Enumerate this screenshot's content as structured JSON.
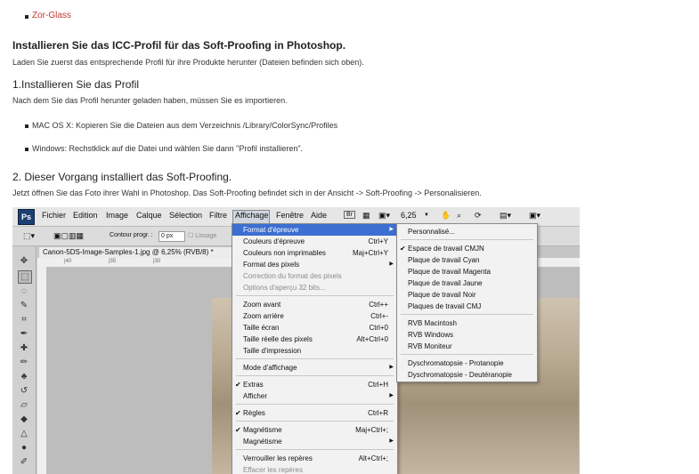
{
  "intro": {
    "link": "Zor-Glass"
  },
  "section1": {
    "heading": "Installieren Sie das ICC-Profil für das Soft-Proofing in Photoshop.",
    "text": "Laden Sie zuerst das entsprechende Profil für ihre Produkte herunter (Dateien befinden sich oben)."
  },
  "section2": {
    "heading": "1.Installieren Sie das Profil",
    "text": "Nach dem Sie das Profil herunter geladen haben, müssen Sie es importieren.",
    "bullets": [
      "MAC OS X: Kopieren Sie die Dateien aus dem Verzeichnis /Library/ColorSync/Profiles",
      "Windows: Rechstklick auf die Datei und wählen Sie dann \"Profil installieren\"."
    ]
  },
  "section3": {
    "heading": "2. Dieser Vorgang installiert das Soft-Proofing.",
    "text": "Jetzt öffnen Sie das Foto ihrer Wahl in Photoshop. Das Soft-Proofing befindet sich in der Ansicht -> Soft-Proofing -> Personalisieren."
  },
  "ps": {
    "logo": "Ps",
    "menus": [
      "Fichier",
      "Edition",
      "Image",
      "Calque",
      "Sélection",
      "Filtre",
      "Affichage",
      "Fenêtre",
      "Aide"
    ],
    "zoom": "6,25",
    "options": {
      "contour_label": "Contour progr. :",
      "contour_value": "0 px",
      "lissage": "Lissage"
    },
    "doc_tab": "Canon-5DS-Image-Samples-1.jpg @ 6,25% (RVB/8) *",
    "ruler_marks": [
      "|40",
      "|35",
      "|30"
    ],
    "dropdown": [
      {
        "label": "Format d'épreuve",
        "shortcut": "",
        "arrow": true,
        "hl": true
      },
      {
        "label": "Couleurs d'épreuve",
        "shortcut": "Ctrl+Y"
      },
      {
        "label": "Couleurs non imprimables",
        "shortcut": "Maj+Ctrl+Y"
      },
      {
        "label": "Format des pixels",
        "shortcut": "",
        "arrow": true
      },
      {
        "label": "Correction du format des pixels",
        "shortcut": "",
        "disabled": true
      },
      {
        "label": "Options d'aperçu 32 bits...",
        "shortcut": "",
        "disabled": true
      },
      {
        "label": "Zoom avant",
        "shortcut": "Ctrl++"
      },
      {
        "label": "Zoom arrière",
        "shortcut": "Ctrl+-"
      },
      {
        "label": "Taille écran",
        "shortcut": "Ctrl+0"
      },
      {
        "label": "Taille réelle des pixels",
        "shortcut": "Alt+Ctrl+0"
      },
      {
        "label": "Taille d'impression",
        "shortcut": ""
      },
      {
        "label": "Mode d'affichage",
        "shortcut": "",
        "arrow": true
      },
      {
        "label": "Extras",
        "shortcut": "Ctrl+H",
        "checked": true
      },
      {
        "label": "Afficher",
        "shortcut": "",
        "arrow": true
      },
      {
        "label": "Règles",
        "shortcut": "Ctrl+R",
        "checked": true
      },
      {
        "label": "Magnétisme",
        "shortcut": "Maj+Ctrl+;",
        "checked": true
      },
      {
        "label": "Magnétisme",
        "shortcut": "",
        "arrow": true
      },
      {
        "label": "Verrouiller les repères",
        "shortcut": "Alt+Ctrl+;"
      },
      {
        "label": "Effacer les repères",
        "shortcut": "",
        "disabled": true
      }
    ],
    "submenu": [
      {
        "label": "Personnalisé..."
      },
      {
        "label": "Espace de travail CMJN",
        "checked": true
      },
      {
        "label": "Plaque de travail Cyan"
      },
      {
        "label": "Plaque de travail Magenta"
      },
      {
        "label": "Plaque de travail Jaune"
      },
      {
        "label": "Plaque de travail Noir"
      },
      {
        "label": "Plaques de travail CMJ"
      },
      {
        "label": "RVB Macintosh"
      },
      {
        "label": "RVB Windows"
      },
      {
        "label": "RVB Moniteur"
      },
      {
        "label": "Dyschromatopsie - Protanopie"
      },
      {
        "label": "Dyschromatopsie - Deutéranopie"
      }
    ]
  }
}
